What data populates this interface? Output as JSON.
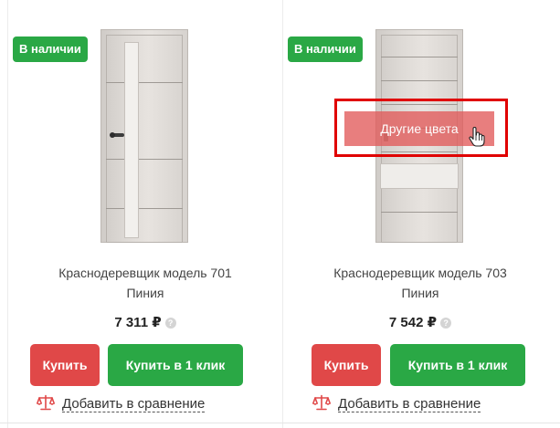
{
  "products": [
    {
      "badge": "В наличии",
      "title_line1": "Краснодеревщик модель 701",
      "title_line2": "Пиния",
      "price": "7 311 ₽",
      "help": "?",
      "buy_label": "Купить",
      "oneclick_label": "Купить в 1 клик",
      "compare_label": "Добавить в сравнение"
    },
    {
      "badge": "В наличии",
      "title_line1": "Краснодеревщик модель 703",
      "title_line2": "Пиния",
      "price": "7 542 ₽",
      "help": "?",
      "buy_label": "Купить",
      "oneclick_label": "Купить в 1 клик",
      "compare_label": "Добавить в сравнение",
      "other_colors_label": "Другие цвета"
    }
  ],
  "icons": {
    "compare": "scales-icon",
    "help": "question-icon",
    "cursor": "hand-pointer-icon"
  },
  "colors": {
    "in_stock": "#2aa845",
    "buy": "#e04848",
    "highlight": "#e00000"
  }
}
